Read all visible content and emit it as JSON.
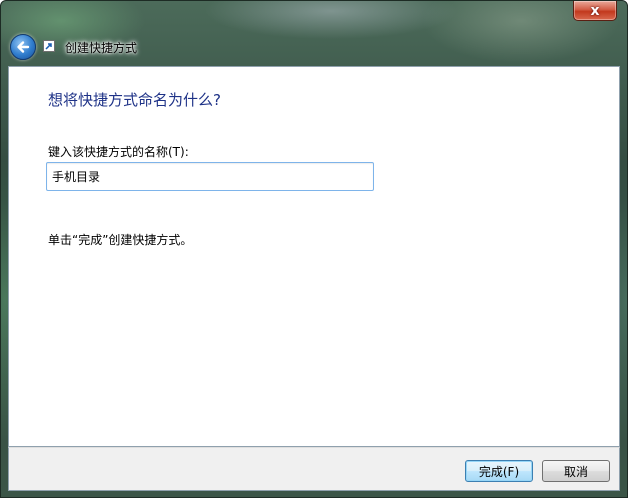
{
  "window": {
    "title": "创建快捷方式",
    "close_label": "x"
  },
  "content": {
    "heading": "想将快捷方式命名为什么?",
    "field_label": "键入该快捷方式的名称(T):",
    "name_value": "手机目录",
    "hint": "单击“完成”创建快捷方式。"
  },
  "footer": {
    "finish_label": "完成(F)",
    "cancel_label": "取消"
  },
  "icons": {
    "back": "arrow-left-icon",
    "app": "shortcut-icon",
    "close": "close-icon"
  }
}
